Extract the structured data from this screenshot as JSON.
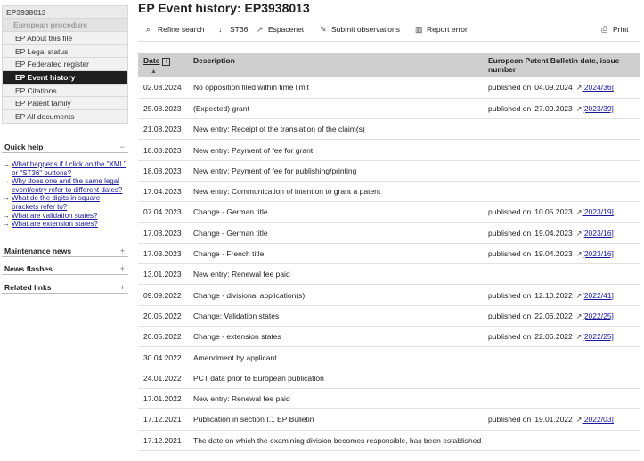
{
  "sidebar": {
    "app_number": "EP3938013",
    "section": "European procedure",
    "items": [
      {
        "label": "EP About this file",
        "active": false
      },
      {
        "label": "EP Legal status",
        "active": false
      },
      {
        "label": "EP Federated register",
        "active": false
      },
      {
        "label": "EP Event history",
        "active": true
      },
      {
        "label": "EP Citations",
        "active": false
      },
      {
        "label": "EP Patent family",
        "active": false
      },
      {
        "label": "EP All documents",
        "active": false
      }
    ]
  },
  "quick_help": {
    "title": "Quick help",
    "toggle": "−",
    "links": [
      "What happens if I click on the \"XML\" or \"ST36\" buttons?",
      "Why does one and the same legal event/entry refer to different dates?",
      "What do the digits in square brackets refer to?",
      "What are validation states?",
      "What are extension states?"
    ]
  },
  "panels": [
    {
      "title": "Maintenance news",
      "toggle": "+"
    },
    {
      "title": "News flashes",
      "toggle": "+"
    },
    {
      "title": "Related links",
      "toggle": "+"
    }
  ],
  "main": {
    "title": "EP Event history: EP3938013",
    "toolbar": {
      "refine": "Refine search",
      "st36": "ST36",
      "espacenet": "Espacenet",
      "submit": "Submit observations",
      "report": "Report error",
      "print": "Print"
    }
  },
  "table": {
    "headers": {
      "date": "Date",
      "info": "i",
      "description": "Description",
      "bulletin": "European Patent Bulletin date, issue number"
    },
    "published_label": "published on",
    "rows": [
      {
        "date": "02.08.2024",
        "desc": "No opposition filed within time limit",
        "pub_date": "04.09.2024",
        "issue": "[2024/36]"
      },
      {
        "date": "25.08.2023",
        "desc": "(Expected) grant",
        "pub_date": "27.09.2023",
        "issue": "[2023/39]"
      },
      {
        "date": "21.08.2023",
        "desc": "New entry: Receipt of the translation of the claim(s)",
        "pub_date": "",
        "issue": ""
      },
      {
        "date": "18.08.2023",
        "desc": "New entry: Payment of fee for grant",
        "pub_date": "",
        "issue": ""
      },
      {
        "date": "18.08.2023",
        "desc": "New entry: Payment of fee for publishing/printing",
        "pub_date": "",
        "issue": ""
      },
      {
        "date": "17.04.2023",
        "desc": "New entry: Communication of intention to grant a patent",
        "pub_date": "",
        "issue": ""
      },
      {
        "date": "07.04.2023",
        "desc": "Change - German title",
        "pub_date": "10.05.2023",
        "issue": "[2023/19]"
      },
      {
        "date": "17.03.2023",
        "desc": "Change - German title",
        "pub_date": "19.04.2023",
        "issue": "[2023/16]"
      },
      {
        "date": "17.03.2023",
        "desc": "Change - French title",
        "pub_date": "19.04.2023",
        "issue": "[2023/16]"
      },
      {
        "date": "13.01.2023",
        "desc": "New entry: Renewal fee paid",
        "pub_date": "",
        "issue": ""
      },
      {
        "date": "09.09.2022",
        "desc": "Change - divisional application(s)",
        "pub_date": "12.10.2022",
        "issue": "[2022/41]"
      },
      {
        "date": "20.05.2022",
        "desc": "Change: Validation states",
        "pub_date": "22.06.2022",
        "issue": "[2022/25]"
      },
      {
        "date": "20.05.2022",
        "desc": "Change - extension states",
        "pub_date": "22.06.2022",
        "issue": "[2022/25]"
      },
      {
        "date": "30.04.2022",
        "desc": "Amendment by applicant",
        "pub_date": "",
        "issue": ""
      },
      {
        "date": "24.01.2022",
        "desc": "PCT data prior to European publication",
        "pub_date": "",
        "issue": ""
      },
      {
        "date": "17.01.2022",
        "desc": "New entry: Renewal fee paid",
        "pub_date": "",
        "issue": ""
      },
      {
        "date": "17.12.2021",
        "desc": "Publication in section I.1 EP Bulletin",
        "pub_date": "19.01.2022",
        "issue": "[2022/03]"
      },
      {
        "date": "17.12.2021",
        "desc": "The date on which the examining division becomes responsible, has been established",
        "pub_date": "",
        "issue": ""
      }
    ]
  }
}
